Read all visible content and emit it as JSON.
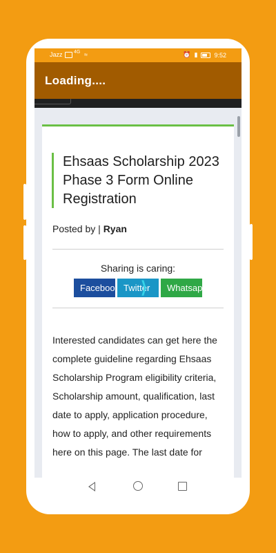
{
  "status_bar": {
    "carrier": "Jazz",
    "network": "4G",
    "time": "9:52",
    "icons": [
      "sim-icon",
      "wifi-icon",
      "alarm-icon",
      "vibrate-icon",
      "battery-icon"
    ]
  },
  "app_bar": {
    "title": "Loading...."
  },
  "article": {
    "title": "Ehsaas Scholarship 2023 Phase 3 Form Online Registration",
    "posted_by_label": "Posted by | ",
    "author": "Ryan",
    "share": {
      "label": "Sharing is caring:",
      "buttons": [
        {
          "label": "Facebook",
          "color": "#1c4e9e"
        },
        {
          "label": "Twitter",
          "color": "#1a96c6"
        },
        {
          "label": "Whatsapp",
          "color": "#2fa846"
        }
      ]
    },
    "body": "Interested candidates can get here the complete guideline regarding Ehsaas Scholarship Program eligibility criteria, Scholarship amount, qualification, last date to apply, application procedure, how to apply, and other requirements here on this page. The last date for"
  },
  "colors": {
    "background": "#f39c12",
    "app_bar": "#a15b00",
    "accent_green": "#6abf45"
  },
  "nav_bar": {
    "icons": [
      "back-icon",
      "home-icon",
      "recent-apps-icon"
    ]
  }
}
